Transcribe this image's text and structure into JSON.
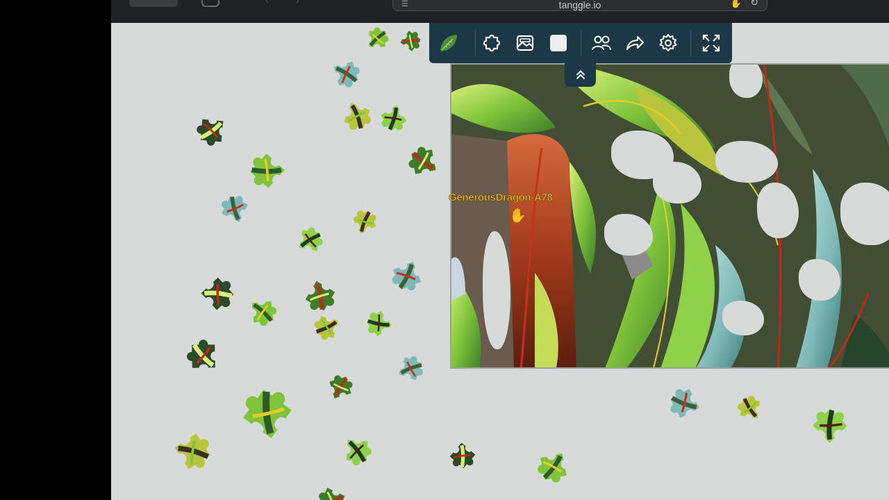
{
  "browser": {
    "address": "tanggle.io"
  },
  "toolbar": {
    "tools": [
      {
        "icon": "leaf-thumbnail-icon"
      },
      {
        "icon": "puzzle-piece-icon"
      },
      {
        "icon": "image-preview-icon"
      },
      {
        "icon": "background-color-icon"
      },
      {
        "icon": "players-icon"
      },
      {
        "icon": "share-icon"
      },
      {
        "icon": "gear-icon"
      },
      {
        "icon": "fullscreen-icon"
      }
    ],
    "collapse_icon": "chevron-up-double-icon"
  },
  "player": {
    "name": "GenerousDragon-A78",
    "color": "#f2c21f"
  },
  "colors": {
    "table_background": "#d8d9d9",
    "toolbar_background": "#1c3746",
    "leaf_green": "#7fc43a",
    "bark_red": "#a43a1c"
  }
}
